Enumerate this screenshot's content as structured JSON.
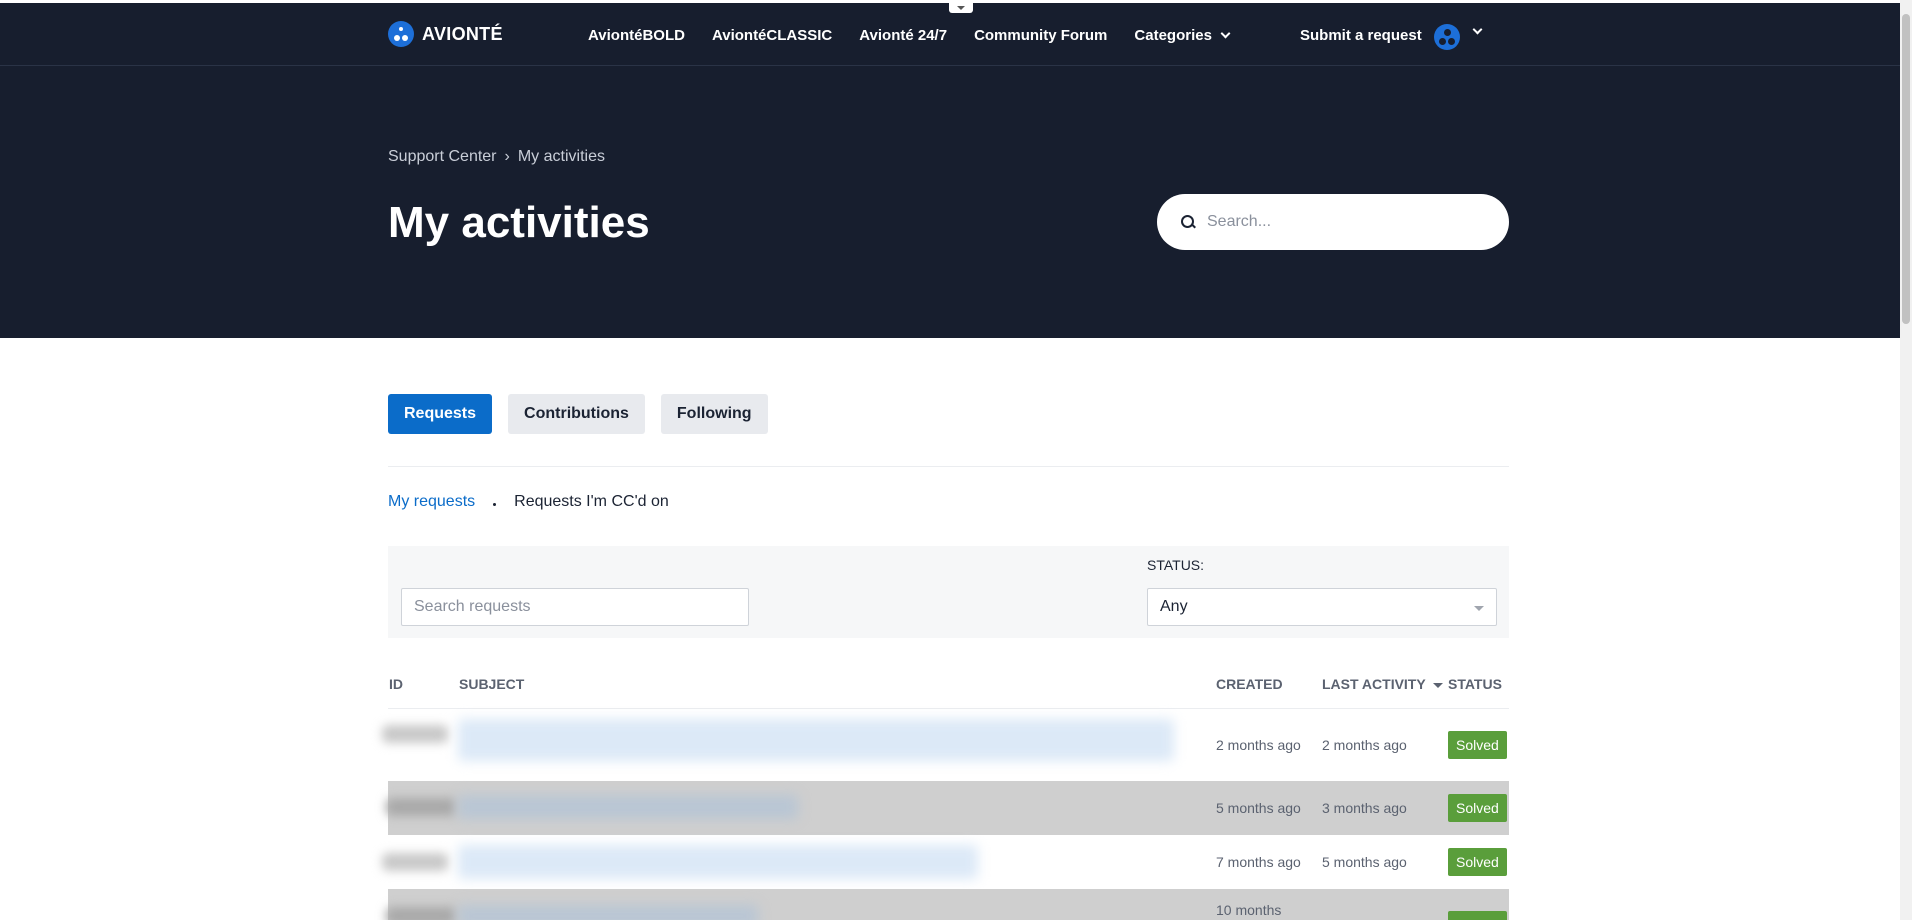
{
  "header": {
    "brand": "AVIONTÉ",
    "nav": [
      "AviontéBOLD",
      "AviontéCLASSIC",
      "Avionté 24/7",
      "Community Forum"
    ],
    "categories_label": "Categories",
    "submit_label": "Submit a request"
  },
  "hero": {
    "breadcrumb": [
      "Support Center",
      "My activities"
    ],
    "breadcrumb_sep": "›",
    "title": "My activities",
    "search_placeholder": "Search..."
  },
  "tabs": [
    {
      "label": "Requests",
      "active": true
    },
    {
      "label": "Contributions",
      "active": false
    },
    {
      "label": "Following",
      "active": false
    }
  ],
  "subtabs": {
    "active": "My requests",
    "other": "Requests I'm CC'd on"
  },
  "filter": {
    "search_placeholder": "Search requests",
    "status_label": "STATUS:",
    "status_value": "Any"
  },
  "table": {
    "columns": {
      "id": "ID",
      "subject": "SUBJECT",
      "created": "CREATED",
      "last_activity": "LAST ACTIVITY",
      "status": "STATUS"
    },
    "rows": [
      {
        "created": "2 months ago",
        "last_activity": "2 months ago",
        "status": "Solved"
      },
      {
        "created": "5 months ago",
        "last_activity": "3 months ago",
        "status": "Solved"
      },
      {
        "created": "7 months ago",
        "last_activity": "5 months ago",
        "status": "Solved"
      },
      {
        "created": "10 months",
        "last_activity": "",
        "status": "Solved"
      }
    ]
  },
  "colors": {
    "header_bg": "#171e2e",
    "accent": "#0b6cc9",
    "solved": "#5a9e3b"
  }
}
